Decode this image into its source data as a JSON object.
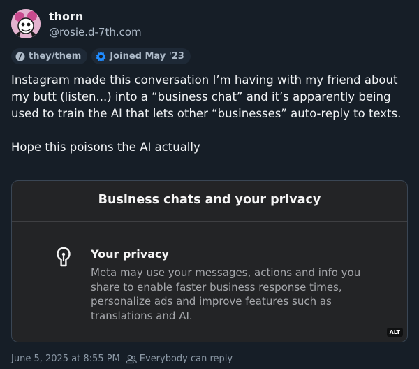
{
  "author": {
    "display_name": "thorn",
    "handle": "@rosie.d-7th.com",
    "avatar_icon": "avatar-cartoon-icon"
  },
  "badges": [
    {
      "label": "they/them",
      "icon": "pronouns-icon"
    },
    {
      "label": "Joined May '23",
      "icon": "joined-badge-icon"
    }
  ],
  "post": {
    "text": "Instagram made this conversation I’m having with my friend about my butt (listen...) into a “business chat” and it’s apparently being used to train the AI that lets other “businesses” auto-reply to texts.\n\nHope this poisons the AI actually"
  },
  "embed": {
    "title": "Business chats and your privacy",
    "item_title": "Your privacy",
    "item_description": "Meta may use your messages, actions and info you share to enable faster business response times, personalize ads and improve features such as translations and AI.",
    "alt_label": "ALT"
  },
  "footer": {
    "timestamp": "June 5, 2025 at 8:55 PM",
    "reply_setting": "Everybody can reply"
  },
  "colors": {
    "background": "#161e27",
    "card": "#232426",
    "muted": "#8b98a5",
    "joined_accent": "#208bfe"
  }
}
